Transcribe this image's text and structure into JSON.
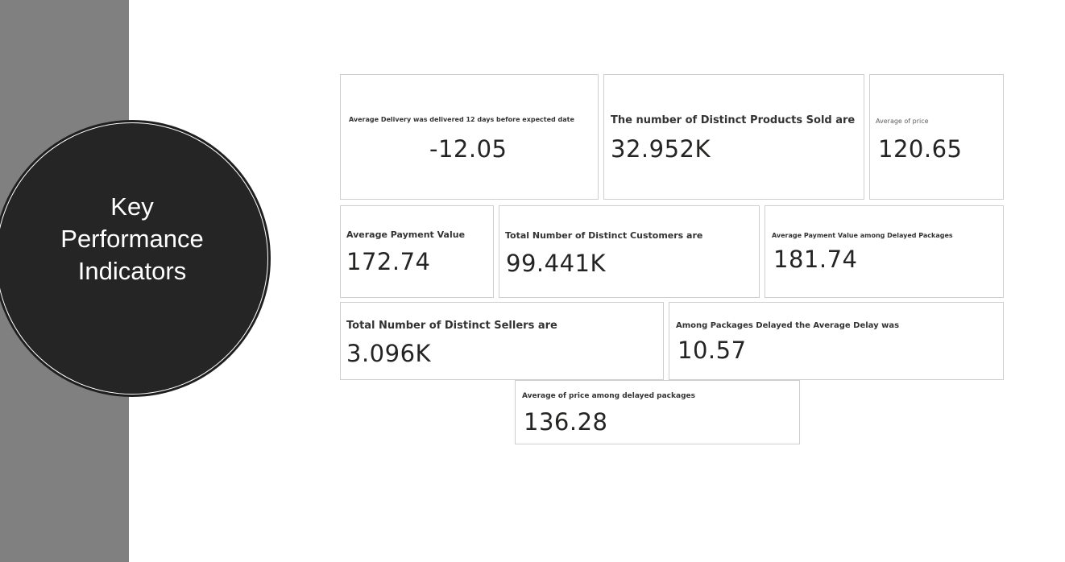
{
  "slide": {
    "title": "Key\nPerformance\nIndicators"
  },
  "kpis": [
    {
      "id": "avg-delivery",
      "label": "Average Delivery was delivered 12 days before expected date",
      "value": "-12.05"
    },
    {
      "id": "distinct-products",
      "label": "The number of Distinct Products Sold are",
      "value": "32.952K"
    },
    {
      "id": "avg-price",
      "label": "Average of price",
      "value": "120.65"
    },
    {
      "id": "avg-payment",
      "label": "Average Payment Value",
      "value": "172.74"
    },
    {
      "id": "distinct-customers",
      "label": "Total Number of Distinct Customers are",
      "value": "99.441K"
    },
    {
      "id": "avg-payment-delayed",
      "label": "Average Payment Value among Delayed Packages",
      "value": "181.74"
    },
    {
      "id": "distinct-sellers",
      "label": "Total Number of Distinct Sellers are",
      "value": "3.096K"
    },
    {
      "id": "avg-delay",
      "label": "Among Packages Delayed the Average Delay was",
      "value": "10.57"
    },
    {
      "id": "avg-price-delayed",
      "label": "Average of price among delayed packages",
      "value": "136.28"
    }
  ]
}
